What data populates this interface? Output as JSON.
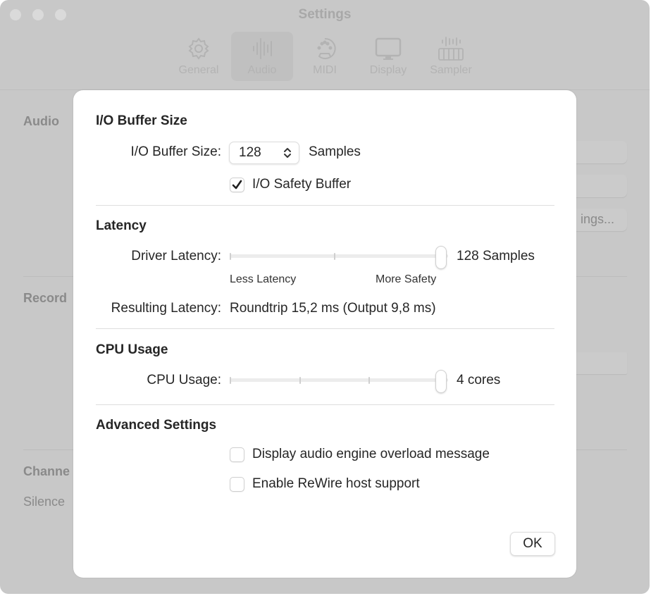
{
  "window": {
    "title": "Settings",
    "toolbar_tabs": [
      {
        "label": "General",
        "icon": "gear-icon",
        "active": false
      },
      {
        "label": "Audio",
        "icon": "waveform-icon",
        "active": true
      },
      {
        "label": "MIDI",
        "icon": "midi-connector-icon",
        "active": false
      },
      {
        "label": "Display",
        "icon": "monitor-icon",
        "active": false
      },
      {
        "label": "Sampler",
        "icon": "sampler-keyboard-icon",
        "active": false
      }
    ]
  },
  "background": {
    "section_audio": "Audio",
    "section_recording": "Record",
    "section_channel": "Channe",
    "silence_text": "Silence",
    "settings_button_fragment": "ings..."
  },
  "dialog": {
    "io_buffer": {
      "title": "I/O Buffer Size",
      "label": "I/O Buffer Size:",
      "value": "128",
      "unit": "Samples",
      "safety_buffer_label": "I/O Safety Buffer",
      "safety_buffer_checked": true
    },
    "latency": {
      "title": "Latency",
      "driver_label": "Driver Latency:",
      "driver_value_text": "128 Samples",
      "driver_slider_position": 1.0,
      "driver_slider_steps": 3,
      "min_label": "Less Latency",
      "max_label": "More Safety",
      "resulting_label": "Resulting Latency:",
      "resulting_value": "Roundtrip 15,2 ms (Output 9,8 ms)"
    },
    "cpu": {
      "title": "CPU Usage",
      "label": "CPU Usage:",
      "value_text": "4 cores",
      "slider_position": 1.0,
      "slider_steps": 4
    },
    "advanced": {
      "title": "Advanced Settings",
      "options": [
        {
          "label": "Display audio engine overload message",
          "checked": false
        },
        {
          "label": "Enable ReWire host support",
          "checked": false
        }
      ]
    },
    "ok_label": "OK"
  }
}
